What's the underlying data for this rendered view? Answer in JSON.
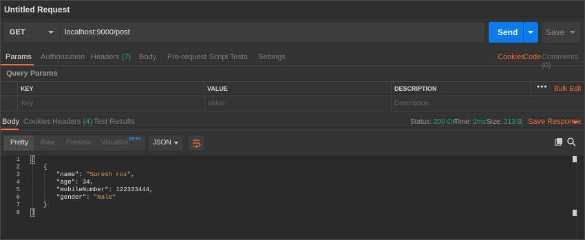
{
  "window": {
    "title": "Untitled Request"
  },
  "request": {
    "method": "GET",
    "url": "localhost:9000/post",
    "send_label": "Send",
    "save_label": "Save"
  },
  "request_tabs": {
    "params": "Params",
    "authorization": "Authorization",
    "headers": "Headers",
    "headers_count": "(7)",
    "body": "Body",
    "prerequest": "Pre-request Script",
    "tests": "Tests",
    "settings": "Settings",
    "cookies": "Cookies",
    "code": "Code",
    "comments": "Comments (0)"
  },
  "query_params": {
    "label": "Query Params",
    "headers": {
      "key": "KEY",
      "value": "VALUE",
      "description": "DESCRIPTION"
    },
    "placeholders": {
      "key": "Key",
      "value": "Value",
      "description": "Description"
    },
    "more": "•••",
    "bulk_edit": "Bulk Edit"
  },
  "response_tabs": {
    "body": "Body",
    "cookies": "Cookies",
    "headers": "Headers",
    "headers_count": "(4)",
    "test_results": "Test Results"
  },
  "response_meta": {
    "status_label": "Status:",
    "status_value": "200 OK",
    "time_label": "Time:",
    "time_value": "2ms",
    "size_label": "Size:",
    "size_value": "213 B",
    "save_response": "Save Response"
  },
  "viewer": {
    "pretty": "Pretty",
    "raw": "Raw",
    "preview": "Preview",
    "visualize": "Visualize",
    "beta": "BETA",
    "format": "JSON"
  },
  "body_lines": {
    "numbers": [
      "1",
      "2",
      "3",
      "4",
      "5",
      "6",
      "7",
      "8"
    ],
    "l1": "[",
    "l2": "{",
    "l3_key": "\"name\"",
    "l3_val": "\"Suresh rox\"",
    "l4_key": "\"age\"",
    "l4_val": "34",
    "l5_key": "\"mobileNumber\"",
    "l5_val": "122333444",
    "l6_key": "\"gender\"",
    "l6_val": "\"male\"",
    "l7": "}",
    "l8": "]"
  },
  "colors": {
    "accent_orange": "#f26b3a",
    "send_blue": "#097bed",
    "teal": "#2d9c8f",
    "string_color": "#d7a266"
  }
}
